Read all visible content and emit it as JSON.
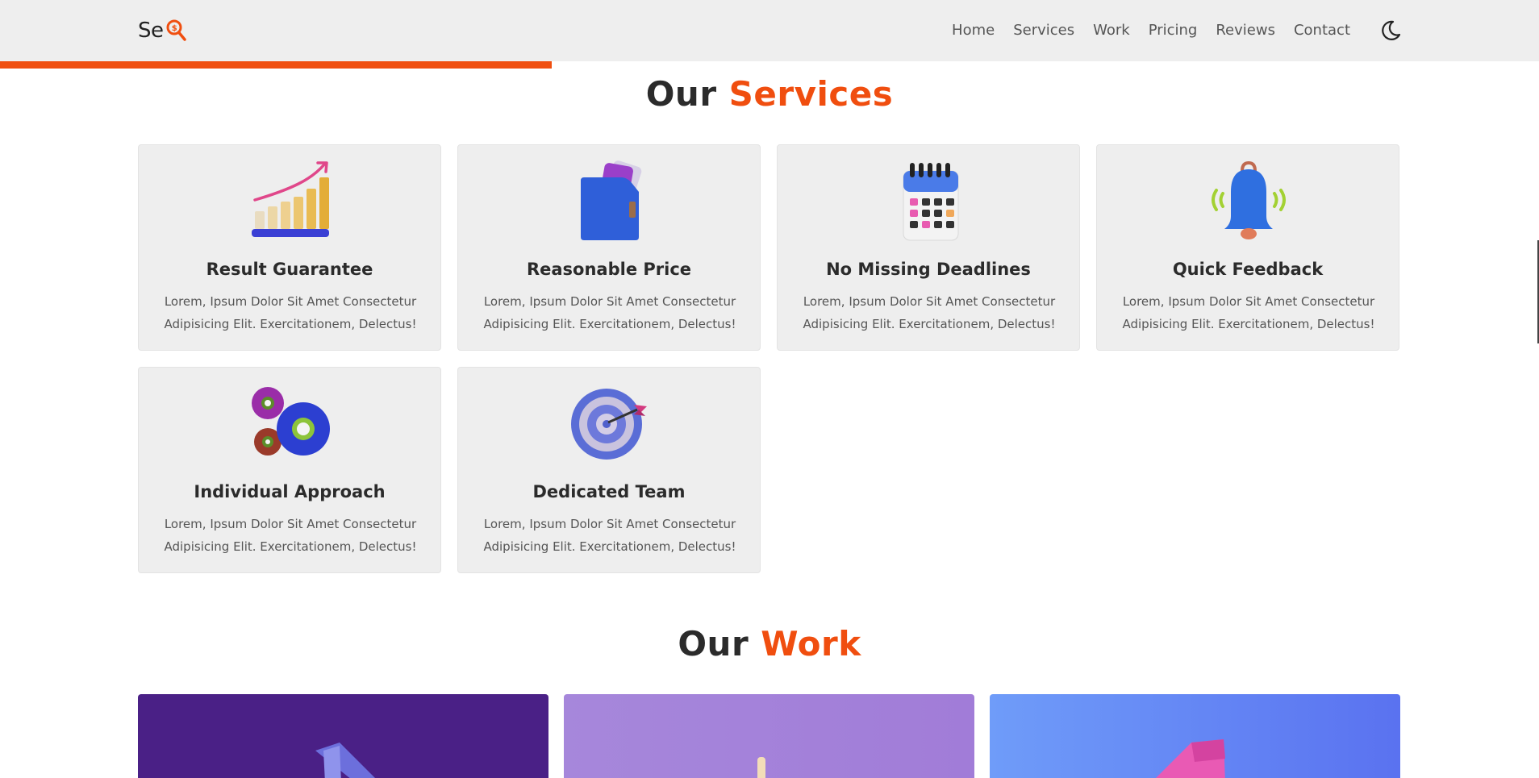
{
  "header": {
    "logo_text": "Se",
    "nav": [
      "Home",
      "Services",
      "Work",
      "Pricing",
      "Reviews",
      "Contact"
    ]
  },
  "services": {
    "title_plain": "Our",
    "title_accent": "Services",
    "cards": [
      {
        "title": "Result Guarantee",
        "desc": "Lorem, Ipsum Dolor Sit Amet Consectetur Adipisicing Elit. Exercitationem, Delectus!",
        "icon": "growth-chart-icon"
      },
      {
        "title": "Reasonable Price",
        "desc": "Lorem, Ipsum Dolor Sit Amet Consectetur Adipisicing Elit. Exercitationem, Delectus!",
        "icon": "wallet-icon"
      },
      {
        "title": "No Missing Deadlines",
        "desc": "Lorem, Ipsum Dolor Sit Amet Consectetur Adipisicing Elit. Exercitationem, Delectus!",
        "icon": "calendar-icon"
      },
      {
        "title": "Quick Feedback",
        "desc": "Lorem, Ipsum Dolor Sit Amet Consectetur Adipisicing Elit. Exercitationem, Delectus!",
        "icon": "bell-icon"
      },
      {
        "title": "Individual Approach",
        "desc": "Lorem, Ipsum Dolor Sit Amet Consectetur Adipisicing Elit. Exercitationem, Delectus!",
        "icon": "gears-icon"
      },
      {
        "title": "Dedicated Team",
        "desc": "Lorem, Ipsum Dolor Sit Amet Consectetur Adipisicing Elit. Exercitationem, Delectus!",
        "icon": "target-icon"
      }
    ]
  },
  "work": {
    "title_plain": "Our",
    "title_accent": "Work"
  },
  "colors": {
    "accent": "#f04e0f",
    "card_bg": "#eeeeee",
    "header_bg": "#eeeeee"
  }
}
